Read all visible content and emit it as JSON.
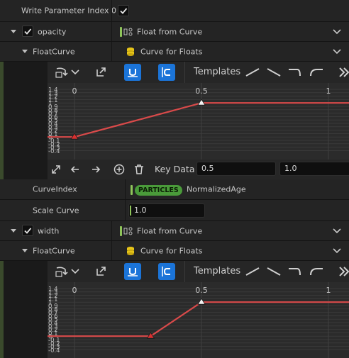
{
  "write_param": {
    "label": "Write Parameter Index 0",
    "checked": true
  },
  "opacity": {
    "label": "opacity",
    "checked": true,
    "source": "Float from Curve",
    "floatcurve_label": "FloatCurve",
    "curve_type": "Curve for Floats",
    "toolbar": {
      "templates_label": "Templates"
    },
    "graph": {
      "x_ticks": [
        "0",
        "0.5",
        "1"
      ],
      "y_ticks": [
        "1.4",
        "1.3",
        "1.2",
        "1.1",
        "1",
        "0.9",
        "0.8",
        "0.7",
        "0.6",
        "0.5",
        "0.4",
        "0.3",
        "0.2",
        "0.1",
        "0",
        "-0.1",
        "-0.2",
        "-0.3",
        "-0.4"
      ],
      "keys": [
        {
          "x": 0,
          "y": 0
        },
        {
          "x": 0.5,
          "y": 1
        }
      ]
    },
    "keydata": {
      "label": "Key Data",
      "time": "0.5",
      "value": "1.0"
    },
    "curveindex": {
      "label": "CurveIndex",
      "badge": "PARTICLES",
      "value": "NormalizedAge"
    },
    "scalecurve": {
      "label": "Scale Curve",
      "value": "1.0"
    }
  },
  "width": {
    "label": "width",
    "checked": true,
    "source": "Float from Curve",
    "floatcurve_label": "FloatCurve",
    "curve_type": "Curve for Floats",
    "toolbar": {
      "templates_label": "Templates"
    },
    "graph": {
      "x_ticks": [
        "0",
        "0.5",
        "1"
      ],
      "y_ticks": [
        "1.4",
        "1.3",
        "1.2",
        "1.1",
        "1",
        "0.9",
        "0.8",
        "0.7",
        "0.6",
        "0.5",
        "0.4",
        "0.3",
        "0.2",
        "0.1",
        "0",
        "-0.1",
        "-0.2",
        "-0.3",
        "-0.4"
      ],
      "keys": [
        {
          "x": 0.3,
          "y": 0
        },
        {
          "x": 0.5,
          "y": 1
        }
      ]
    }
  },
  "colors": {
    "accent": "#1b74d8",
    "curve": "#d94a4a",
    "badge": "#4a9b3a",
    "indicator": "#8fc55a"
  }
}
